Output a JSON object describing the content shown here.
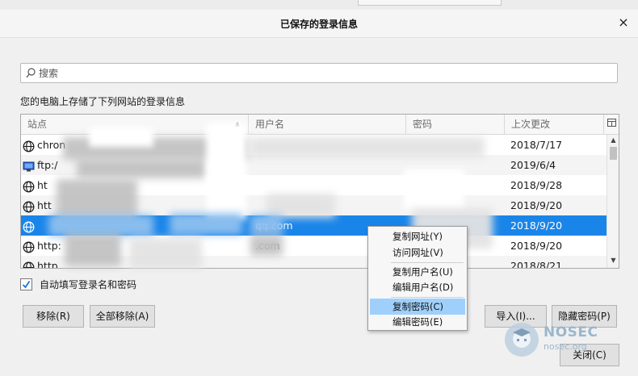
{
  "dialog": {
    "title": "已保存的登录信息",
    "close_glyph": "×"
  },
  "search": {
    "placeholder": "搜索",
    "value": ""
  },
  "description": "您的电脑上存储了下列网站的登录信息",
  "table": {
    "columns": {
      "site": "站点",
      "username": "用户名",
      "password": "密码",
      "last_changed": "上次更改"
    },
    "sort_indicator": "▲",
    "rows": [
      {
        "site": "chron",
        "username": "",
        "last_changed": "2018/7/17",
        "icon": "globe-icon"
      },
      {
        "site": "ftp:/",
        "username": "",
        "last_changed": "2019/6/4",
        "icon": "ftp-monitor-icon"
      },
      {
        "site": "ht",
        "username": "",
        "last_changed": "2018/9/28",
        "icon": "globe-icon"
      },
      {
        "site": "htt",
        "username": "",
        "last_changed": "2018/9/20",
        "icon": "globe-icon"
      },
      {
        "site": "",
        "username": "qq.com",
        "last_changed": "2018/9/20",
        "icon": "globe-icon",
        "selected": true
      },
      {
        "site": "http:",
        "username": ".com",
        "last_changed": "2018/9/20",
        "icon": "globe-icon"
      },
      {
        "site": "http",
        "username": "",
        "last_changed": "2018/8/21",
        "icon": "globe-icon"
      }
    ]
  },
  "autofill": {
    "label": "自动填写登录名和密码",
    "checked": true
  },
  "buttons": {
    "remove": "移除(R)",
    "remove_all": "全部移除(A)",
    "import": "导入(I)...",
    "hide_passwords": "隐藏密码(P)",
    "close": "关闭(C)"
  },
  "context_menu": {
    "items": [
      {
        "label": "复制网址(Y)"
      },
      {
        "label": "访问网址(V)"
      },
      {
        "label": "复制用户名(U)"
      },
      {
        "label": "编辑用户名(D)"
      },
      {
        "label": "复制密码(C)",
        "highlighted": true
      },
      {
        "label": "编辑密码(E)"
      }
    ]
  },
  "watermark": {
    "name": "NOSEC",
    "sub": "nosec.org"
  },
  "colors": {
    "selection": "#1a85e8",
    "menu_highlight": "#9fd0fb",
    "watermark": "#9bb6cc"
  }
}
